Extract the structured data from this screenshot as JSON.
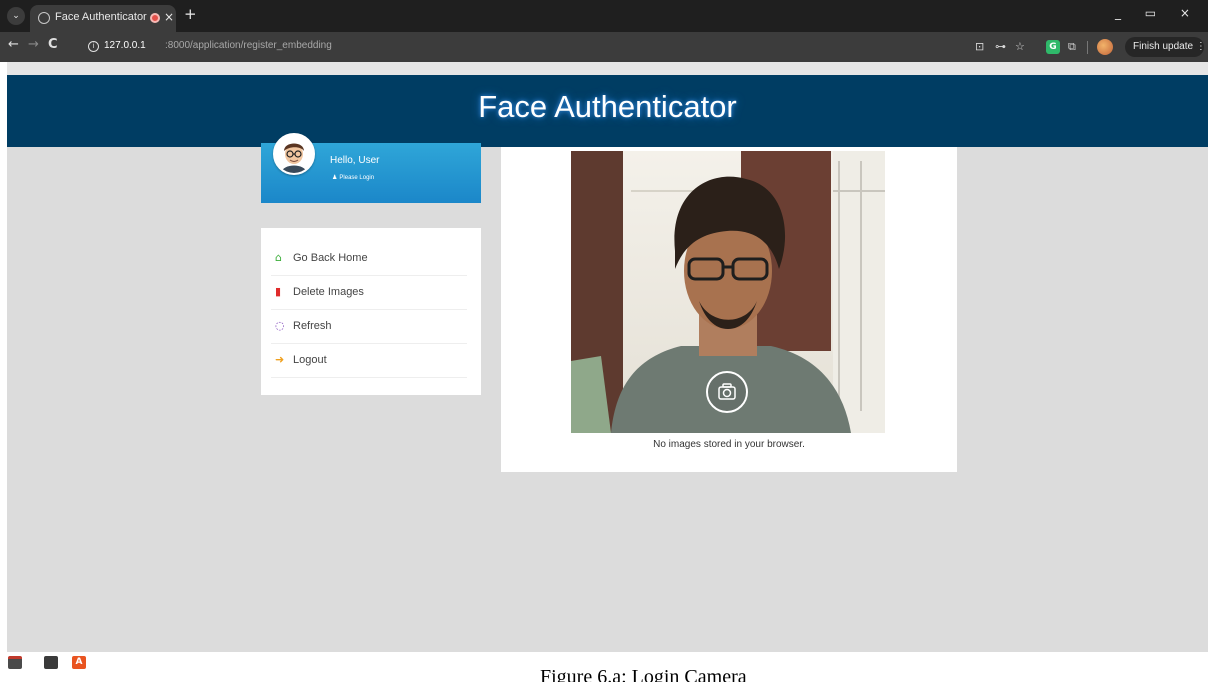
{
  "browser": {
    "tab_title": "Face Authenticator",
    "tab_close": "×",
    "new_tab": "+",
    "menu_glyph": "⌄",
    "window_controls": "_ ▭ ×",
    "url_host": "127.0.0.1",
    "url_path": ":8000/application/register_embedding",
    "finish_update": "Finish update ⋮",
    "nav": {
      "back": "←",
      "forward": "→",
      "reload": "C"
    },
    "toolbar_icons": [
      "cast-icon",
      "key-icon",
      "star-icon",
      "grammarly-icon",
      "extensions-icon"
    ],
    "extension_letter": "G"
  },
  "app": {
    "title": "Face Authenticator",
    "header_color": "#003d63"
  },
  "profile": {
    "greeting": "Hello, User",
    "login_hint": "Please Login",
    "user_glyph": "♟"
  },
  "menu": {
    "items": [
      {
        "label": "Go Back Home",
        "icon": "home-icon",
        "glyph": "⌂",
        "color": "#3cae3a"
      },
      {
        "label": "Delete Images",
        "icon": "trash-icon",
        "glyph": "▮",
        "color": "#e02b2b"
      },
      {
        "label": "Refresh",
        "icon": "spinner-icon",
        "glyph": "◌",
        "color": "#7b3fb8"
      },
      {
        "label": "Logout",
        "icon": "logout-icon",
        "glyph": "➜",
        "color": "#f0a120"
      }
    ]
  },
  "camera": {
    "status": "No images stored in your browser."
  },
  "caption": "Figure 6.a: Login Camera"
}
